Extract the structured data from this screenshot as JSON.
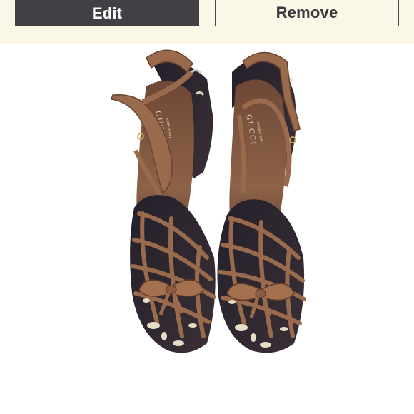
{
  "toolbar": {
    "edit_label": "Edit",
    "remove_label": "Remove"
  },
  "photo": {
    "brand_mark": "GUCCI",
    "insole_text": "made in Italy"
  },
  "colors": {
    "toolbar_bg": "#fbf7e6",
    "edit_bg": "#424045",
    "leather": "#9a6a4c",
    "insole": "#7a523c",
    "fabric": "#2e2530"
  }
}
